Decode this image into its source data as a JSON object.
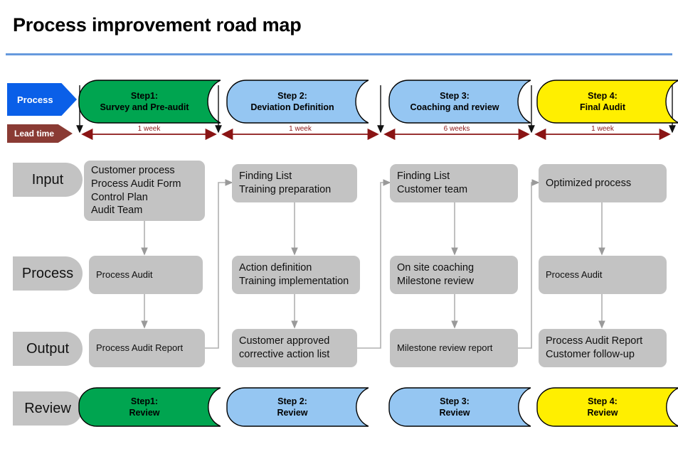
{
  "title": "Process improvement road map",
  "accent_rule_color": "#6699dd",
  "tags": {
    "process": {
      "label": "Process",
      "color": "#0a5fe8"
    },
    "lead_time": {
      "label": "Lead time",
      "color": "#8a3b34"
    }
  },
  "row_labels": [
    {
      "name": "input",
      "label": "Input"
    },
    {
      "name": "process",
      "label": "Process"
    },
    {
      "name": "output",
      "label": "Output"
    },
    {
      "name": "review",
      "label": "Review"
    }
  ],
  "steps": [
    {
      "id": "step1",
      "color": "#00a550",
      "banner_line1": "Step1:",
      "banner_line2": "Survey and Pre-audit",
      "lead_time": "1 week",
      "review_line1": "Step1:",
      "review_line2": "Review",
      "input": [
        "Customer process",
        "Process Audit Form",
        "Control Plan",
        "Audit Team"
      ],
      "process": [
        "Process Audit"
      ],
      "output": [
        "Process Audit Report"
      ]
    },
    {
      "id": "step2",
      "color": "#95c6f2",
      "banner_line1": "Step 2:",
      "banner_line2": "Deviation Definition",
      "lead_time": "1 week",
      "review_line1": "Step 2:",
      "review_line2": "Review",
      "input": [
        "Finding List",
        "Training preparation"
      ],
      "process": [
        "Action definition",
        "Training implementation"
      ],
      "output": [
        "Customer approved",
        "corrective action list"
      ]
    },
    {
      "id": "step3",
      "color": "#95c6f2",
      "banner_line1": "Step 3:",
      "banner_line2": "Coaching and review",
      "lead_time": "6 weeks",
      "review_line1": "Step 3:",
      "review_line2": "Review",
      "input": [
        "Finding List",
        "Customer team"
      ],
      "process": [
        "On site coaching",
        "Milestone review"
      ],
      "output": [
        "Milestone review report"
      ]
    },
    {
      "id": "step4",
      "color": "#ffef00",
      "banner_line1": "Step 4:",
      "banner_line2": "Final Audit",
      "lead_time": "1 week",
      "review_line1": "Step 4:",
      "review_line2": "Review",
      "input": [
        "Optimized process"
      ],
      "process": [
        "Process Audit"
      ],
      "output": [
        "Process Audit Report",
        "Customer follow-up"
      ]
    }
  ]
}
